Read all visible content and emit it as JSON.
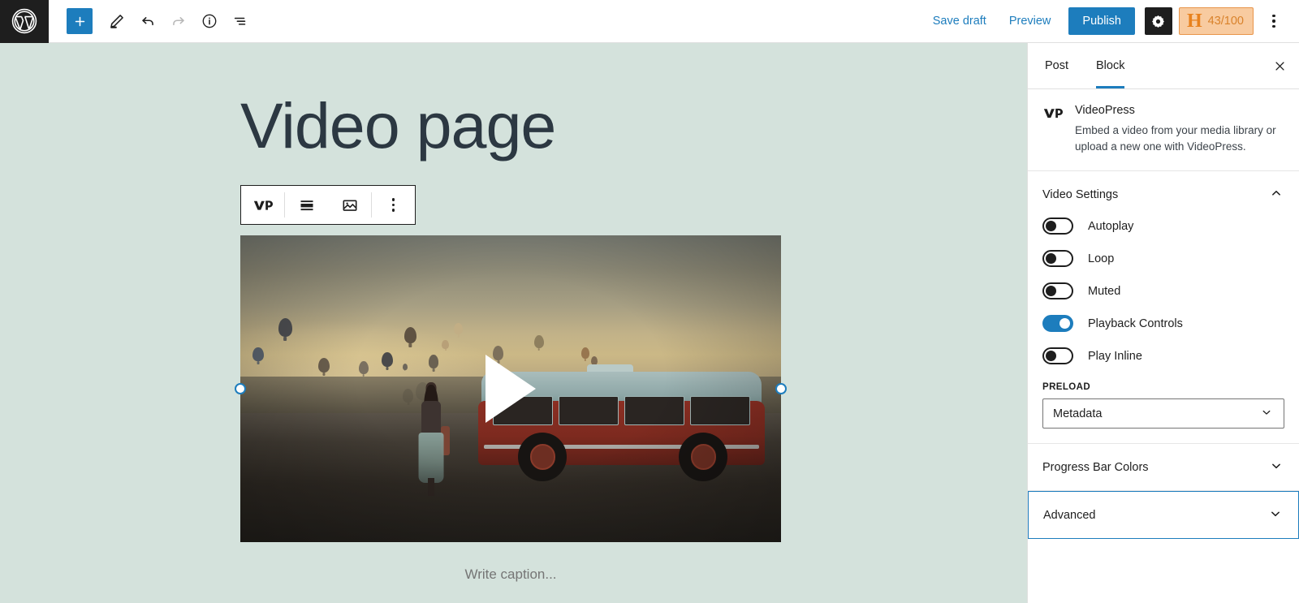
{
  "header": {
    "logo_icon": "wordpress-logo-icon",
    "tools": [
      {
        "name": "block-inserter",
        "icon": "plus-icon"
      },
      {
        "name": "tools-edit",
        "icon": "pencil-icon"
      },
      {
        "name": "undo",
        "icon": "undo-arrow-icon"
      },
      {
        "name": "redo",
        "icon": "redo-arrow-icon"
      },
      {
        "name": "details",
        "icon": "info-circle-icon"
      },
      {
        "name": "list-view",
        "icon": "list-view-icon"
      }
    ],
    "save_draft_label": "Save draft",
    "preview_label": "Preview",
    "publish_label": "Publish",
    "settings_icon": "gear-icon",
    "seo_badge": {
      "letter": "H",
      "score": "43/100"
    },
    "more_menu_icon": "kebab-menu-icon"
  },
  "editor": {
    "title": "Video page",
    "caption_placeholder": "Write caption...",
    "block_toolbar": [
      {
        "name": "block-type-videopress",
        "icon": "videopress-icon"
      },
      {
        "name": "align-block",
        "icon": "align-center-icon"
      },
      {
        "name": "poster-image",
        "icon": "image-icon"
      },
      {
        "name": "block-options",
        "icon": "kebab-menu-icon"
      }
    ],
    "play_button_label": "play-triangle-icon"
  },
  "sidebar": {
    "tabs": [
      {
        "label": "Post",
        "active": false
      },
      {
        "label": "Block",
        "active": true
      }
    ],
    "close_icon": "close-icon",
    "block": {
      "icon": "videopress-icon",
      "name": "VideoPress",
      "description": "Embed a video from your media library or upload a new one with VideoPress."
    },
    "panels": [
      {
        "title": "Video Settings",
        "expanded": true,
        "chevron": "chevron-up-icon",
        "toggles": [
          {
            "label": "Autoplay",
            "on": false
          },
          {
            "label": "Loop",
            "on": false
          },
          {
            "label": "Muted",
            "on": false
          },
          {
            "label": "Playback Controls",
            "on": true
          },
          {
            "label": "Play Inline",
            "on": false
          }
        ],
        "preload": {
          "label": "PRELOAD",
          "value": "Metadata",
          "chevron": "chevron-down-icon"
        }
      },
      {
        "title": "Progress Bar Colors",
        "expanded": false,
        "chevron": "chevron-down-icon"
      },
      {
        "title": "Advanced",
        "expanded": false,
        "focused": true,
        "chevron": "chevron-down-icon"
      }
    ]
  },
  "colors": {
    "accent": "#1d7dbd",
    "canvas_bg": "#d4e2dc",
    "title_text": "#2c3842",
    "seo_badge_bg": "#f8cba0",
    "seo_badge_text": "#e8821e"
  }
}
